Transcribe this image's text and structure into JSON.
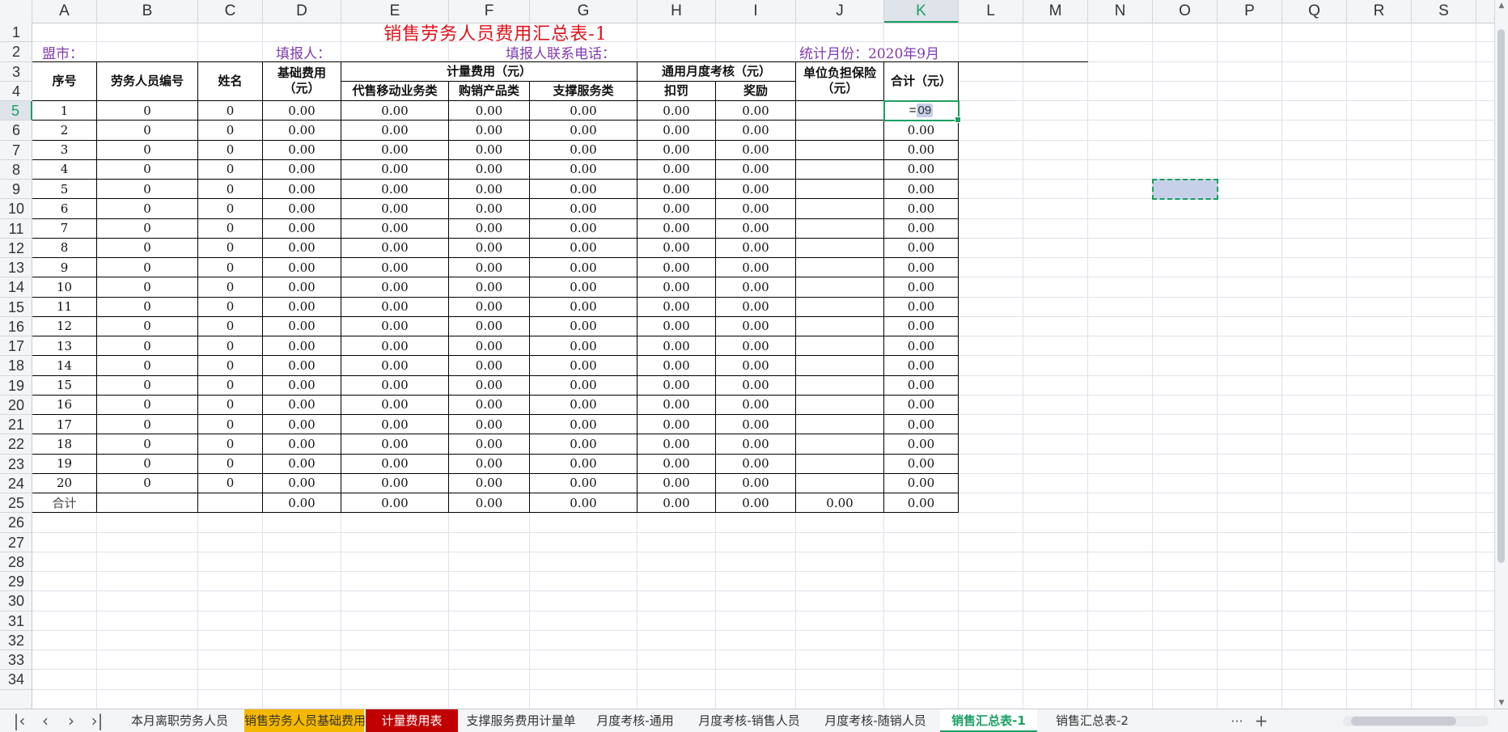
{
  "columns": [
    "A",
    "B",
    "C",
    "D",
    "E",
    "F",
    "G",
    "H",
    "I",
    "J",
    "K",
    "L",
    "M",
    "N",
    "O",
    "P",
    "Q",
    "R",
    "S"
  ],
  "rows": [
    "1",
    "2",
    "3",
    "4",
    "5",
    "6",
    "7",
    "8",
    "9",
    "10",
    "11",
    "12",
    "13",
    "14",
    "15",
    "16",
    "17",
    "18",
    "19",
    "20",
    "21",
    "22",
    "23",
    "24",
    "25",
    "26",
    "27",
    "28",
    "29",
    "30",
    "31",
    "32",
    "33",
    "34"
  ],
  "active_cell": "K5",
  "sheet": {
    "title": "销售劳务人员费用汇总表-1",
    "league_city_label": "盟市：",
    "reporter_label": "填报人：",
    "reporter_phone_label": "填报人联系电话：",
    "stat_month_label": "统计月份：2020年9月",
    "headers": {
      "seq": "序号",
      "staff_no": "劳务人员编号",
      "name": "姓名",
      "base_fee": "基础费用",
      "base_fee_unit": "（元）",
      "metered_fee": "计量费用（元）",
      "agency_mobile": "代售移动业务类",
      "purchase_sales": "购销产品类",
      "support_service": "支撑服务类",
      "monthly_review": "通用月度考核（元）",
      "deduct": "扣罚",
      "reward": "奖励",
      "insurance": "单位负担保险",
      "insurance_unit": "（元）",
      "total": "合计（元）"
    },
    "data_rows": [
      {
        "seq": "1",
        "staff_no": "0",
        "name": "0",
        "d": "0.00",
        "e": "0.00",
        "f": "0.00",
        "g": "0.00",
        "h": "0.00",
        "i": "0.00",
        "j": "",
        "k": "=09"
      },
      {
        "seq": "2",
        "staff_no": "0",
        "name": "0",
        "d": "0.00",
        "e": "0.00",
        "f": "0.00",
        "g": "0.00",
        "h": "0.00",
        "i": "0.00",
        "j": "",
        "k": "0.00"
      },
      {
        "seq": "3",
        "staff_no": "0",
        "name": "0",
        "d": "0.00",
        "e": "0.00",
        "f": "0.00",
        "g": "0.00",
        "h": "0.00",
        "i": "0.00",
        "j": "",
        "k": "0.00"
      },
      {
        "seq": "4",
        "staff_no": "0",
        "name": "0",
        "d": "0.00",
        "e": "0.00",
        "f": "0.00",
        "g": "0.00",
        "h": "0.00",
        "i": "0.00",
        "j": "",
        "k": "0.00"
      },
      {
        "seq": "5",
        "staff_no": "0",
        "name": "0",
        "d": "0.00",
        "e": "0.00",
        "f": "0.00",
        "g": "0.00",
        "h": "0.00",
        "i": "0.00",
        "j": "",
        "k": "0.00"
      },
      {
        "seq": "6",
        "staff_no": "0",
        "name": "0",
        "d": "0.00",
        "e": "0.00",
        "f": "0.00",
        "g": "0.00",
        "h": "0.00",
        "i": "0.00",
        "j": "",
        "k": "0.00"
      },
      {
        "seq": "7",
        "staff_no": "0",
        "name": "0",
        "d": "0.00",
        "e": "0.00",
        "f": "0.00",
        "g": "0.00",
        "h": "0.00",
        "i": "0.00",
        "j": "",
        "k": "0.00"
      },
      {
        "seq": "8",
        "staff_no": "0",
        "name": "0",
        "d": "0.00",
        "e": "0.00",
        "f": "0.00",
        "g": "0.00",
        "h": "0.00",
        "i": "0.00",
        "j": "",
        "k": "0.00"
      },
      {
        "seq": "9",
        "staff_no": "0",
        "name": "0",
        "d": "0.00",
        "e": "0.00",
        "f": "0.00",
        "g": "0.00",
        "h": "0.00",
        "i": "0.00",
        "j": "",
        "k": "0.00"
      },
      {
        "seq": "10",
        "staff_no": "0",
        "name": "0",
        "d": "0.00",
        "e": "0.00",
        "f": "0.00",
        "g": "0.00",
        "h": "0.00",
        "i": "0.00",
        "j": "",
        "k": "0.00"
      },
      {
        "seq": "11",
        "staff_no": "0",
        "name": "0",
        "d": "0.00",
        "e": "0.00",
        "f": "0.00",
        "g": "0.00",
        "h": "0.00",
        "i": "0.00",
        "j": "",
        "k": "0.00"
      },
      {
        "seq": "12",
        "staff_no": "0",
        "name": "0",
        "d": "0.00",
        "e": "0.00",
        "f": "0.00",
        "g": "0.00",
        "h": "0.00",
        "i": "0.00",
        "j": "",
        "k": "0.00"
      },
      {
        "seq": "13",
        "staff_no": "0",
        "name": "0",
        "d": "0.00",
        "e": "0.00",
        "f": "0.00",
        "g": "0.00",
        "h": "0.00",
        "i": "0.00",
        "j": "",
        "k": "0.00"
      },
      {
        "seq": "14",
        "staff_no": "0",
        "name": "0",
        "d": "0.00",
        "e": "0.00",
        "f": "0.00",
        "g": "0.00",
        "h": "0.00",
        "i": "0.00",
        "j": "",
        "k": "0.00"
      },
      {
        "seq": "15",
        "staff_no": "0",
        "name": "0",
        "d": "0.00",
        "e": "0.00",
        "f": "0.00",
        "g": "0.00",
        "h": "0.00",
        "i": "0.00",
        "j": "",
        "k": "0.00"
      },
      {
        "seq": "16",
        "staff_no": "0",
        "name": "0",
        "d": "0.00",
        "e": "0.00",
        "f": "0.00",
        "g": "0.00",
        "h": "0.00",
        "i": "0.00",
        "j": "",
        "k": "0.00"
      },
      {
        "seq": "17",
        "staff_no": "0",
        "name": "0",
        "d": "0.00",
        "e": "0.00",
        "f": "0.00",
        "g": "0.00",
        "h": "0.00",
        "i": "0.00",
        "j": "",
        "k": "0.00"
      },
      {
        "seq": "18",
        "staff_no": "0",
        "name": "0",
        "d": "0.00",
        "e": "0.00",
        "f": "0.00",
        "g": "0.00",
        "h": "0.00",
        "i": "0.00",
        "j": "",
        "k": "0.00"
      },
      {
        "seq": "19",
        "staff_no": "0",
        "name": "0",
        "d": "0.00",
        "e": "0.00",
        "f": "0.00",
        "g": "0.00",
        "h": "0.00",
        "i": "0.00",
        "j": "",
        "k": "0.00"
      },
      {
        "seq": "20",
        "staff_no": "0",
        "name": "0",
        "d": "0.00",
        "e": "0.00",
        "f": "0.00",
        "g": "0.00",
        "h": "0.00",
        "i": "0.00",
        "j": "",
        "k": "0.00"
      }
    ],
    "total_row": {
      "seq": "合计",
      "staff_no": "",
      "name": "",
      "d": "0.00",
      "e": "0.00",
      "f": "0.00",
      "g": "0.00",
      "h": "0.00",
      "i": "0.00",
      "j": "0.00",
      "k": "0.00"
    }
  },
  "formula_in_cell": {
    "prefix": "=",
    "ref": "09"
  },
  "tab_nav": {
    "first": "first-sheet-icon",
    "prev": "prev-sheet-icon",
    "next": "next-sheet-icon",
    "last": "last-sheet-icon"
  },
  "tabs": [
    {
      "label": "本月离职劳务人员",
      "color": "",
      "active": false
    },
    {
      "label": "销售劳务人员基础费用",
      "color": "#f5b800",
      "active": false
    },
    {
      "label": "计量费用表",
      "color": "#c00000",
      "active": false
    },
    {
      "label": "支撑服务费用计量单",
      "color": "",
      "active": false
    },
    {
      "label": "月度考核-通用",
      "color": "",
      "active": false
    },
    {
      "label": "月度考核-销售人员",
      "color": "",
      "active": false
    },
    {
      "label": "月度考核-随销人员",
      "color": "",
      "active": false
    },
    {
      "label": "销售汇总表-1",
      "color": "",
      "active": true
    },
    {
      "label": "销售汇总表-2",
      "color": "",
      "active": false
    }
  ],
  "tab_more": "···",
  "tab_add": "+",
  "colors": {
    "accent": "#1a9f63",
    "title": "#e0101a",
    "label": "#7f3ab0",
    "selection": "#c6d1e9"
  }
}
